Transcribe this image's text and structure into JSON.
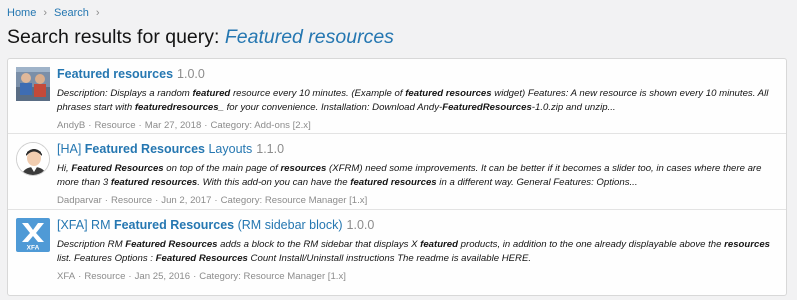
{
  "breadcrumb": {
    "home": "Home",
    "search": "Search",
    "separator": "›"
  },
  "title": {
    "prefix": "Search results for query: ",
    "query": "Featured resources"
  },
  "colors": {
    "link": "#2577b1",
    "muted": "#8c8c8c",
    "xfa_blue": "#4f9ad6"
  },
  "results": [
    {
      "avatar_icon": "user-photo-avatar",
      "title_strong": "Featured resources",
      "version": "1.0.0",
      "snippet": [
        {
          "t": "Description: Displays a random "
        },
        {
          "b": "featured"
        },
        {
          "t": " resource every 10 minutes. (Example of "
        },
        {
          "b": "featured resources"
        },
        {
          "t": " widget) Features: A new resource is shown every 10 minutes. All phrases start with "
        },
        {
          "b": "featuredresources"
        },
        {
          "t": "_ for your convenience. Installation: Download Andy-"
        },
        {
          "b": "FeaturedResources"
        },
        {
          "t": "-1.0.zip and unzip..."
        }
      ],
      "author": "AndyB",
      "type": "Resource",
      "date": "Mar 27, 2018",
      "category": "Category: Add-ons [2.x]"
    },
    {
      "avatar_icon": "user-portrait-avatar",
      "title_prefix": "[HA] ",
      "title_strong": "Featured Resources",
      "title_suffix": " Layouts",
      "version": "1.1.0",
      "snippet": [
        {
          "t": "Hi, "
        },
        {
          "b": "Featured Resources"
        },
        {
          "t": " on top of the main page of "
        },
        {
          "b": "resources"
        },
        {
          "t": " (XFRM) need some improvements. It can be better if it becomes a slider too, in cases where there are more than 3 "
        },
        {
          "b": "featured resources"
        },
        {
          "t": ". With this add-on you can have the "
        },
        {
          "b": "featured resources"
        },
        {
          "t": " in a different way. General Features: Options..."
        }
      ],
      "author": "Dadparvar",
      "type": "Resource",
      "date": "Jun 2, 2017",
      "category": "Category: Resource Manager [1.x]"
    },
    {
      "avatar_icon": "xfa-logo-icon",
      "avatar_text": "XFA",
      "title_prefix": "[XFA] RM ",
      "title_strong": "Featured Resources",
      "title_suffix": " (RM sidebar block)",
      "version": "1.0.0",
      "snippet": [
        {
          "t": "Description RM "
        },
        {
          "b": "Featured Resources"
        },
        {
          "t": " adds a block to the RM sidebar that displays X "
        },
        {
          "b": "featured"
        },
        {
          "t": " products, in addition to the one already displayable above the "
        },
        {
          "b": "resources"
        },
        {
          "t": " list. Features Options : "
        },
        {
          "b": "Featured Resources"
        },
        {
          "t": " Count Install/Uninstall instructions The readme is available HERE."
        }
      ],
      "author": "XFA",
      "type": "Resource",
      "date": "Jan 25, 2016",
      "category": "Category: Resource Manager [1.x]"
    }
  ]
}
